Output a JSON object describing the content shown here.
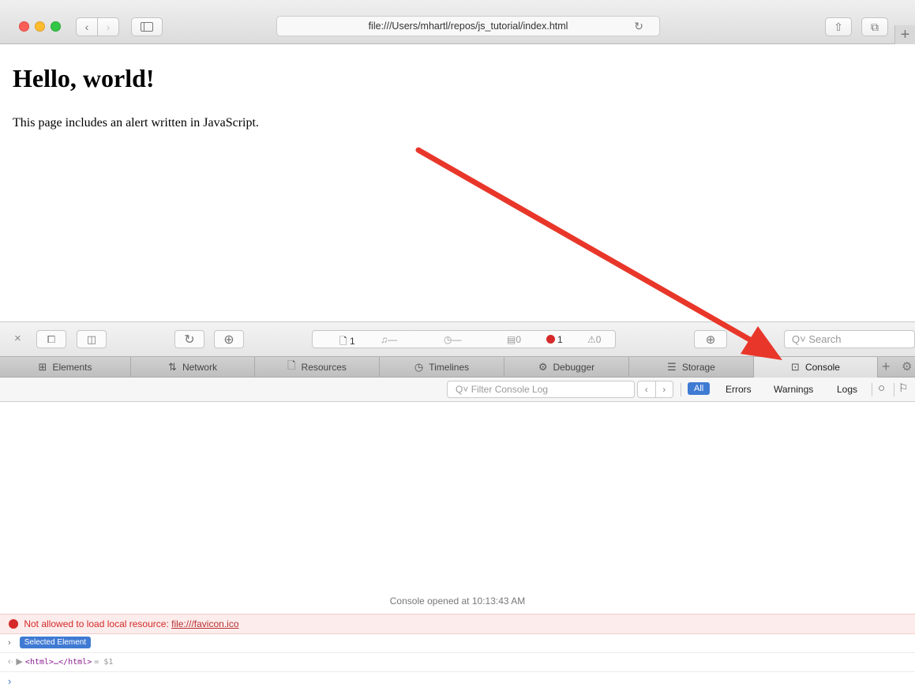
{
  "browser": {
    "url": "file:///Users/mhartl/repos/js_tutorial/index.html"
  },
  "page": {
    "heading": "Hello, world!",
    "paragraph": "This page includes an alert written in JavaScript."
  },
  "inspector": {
    "activity": {
      "resources_count": "1",
      "network_value": "—",
      "time_value": "—",
      "logs_count": "0",
      "errors_count": "1",
      "warnings_count": "0"
    },
    "search_placeholder": "Search",
    "tabs": [
      {
        "label": "Elements",
        "icon": "elements-icon"
      },
      {
        "label": "Network",
        "icon": "network-icon"
      },
      {
        "label": "Resources",
        "icon": "resources-icon"
      },
      {
        "label": "Timelines",
        "icon": "timelines-icon"
      },
      {
        "label": "Debugger",
        "icon": "debugger-icon"
      },
      {
        "label": "Storage",
        "icon": "storage-icon"
      },
      {
        "label": "Console",
        "icon": "console-icon",
        "active": true
      }
    ]
  },
  "console": {
    "filter_placeholder": "Filter Console Log",
    "levels": [
      "All",
      "Errors",
      "Warnings",
      "Logs"
    ],
    "active_level": "All",
    "opened_message": "Console opened at 10:13:43 AM",
    "error": {
      "text": "Not allowed to load local resource:",
      "link": "file:///favicon.ico"
    },
    "selected_label": "Selected Element",
    "html_snippet": "<html>…</html>",
    "html_var": "= $1"
  },
  "colors": {
    "accent": "#3f7ad3",
    "error": "#d42a2a",
    "annotation_arrow": "#e8372a"
  }
}
